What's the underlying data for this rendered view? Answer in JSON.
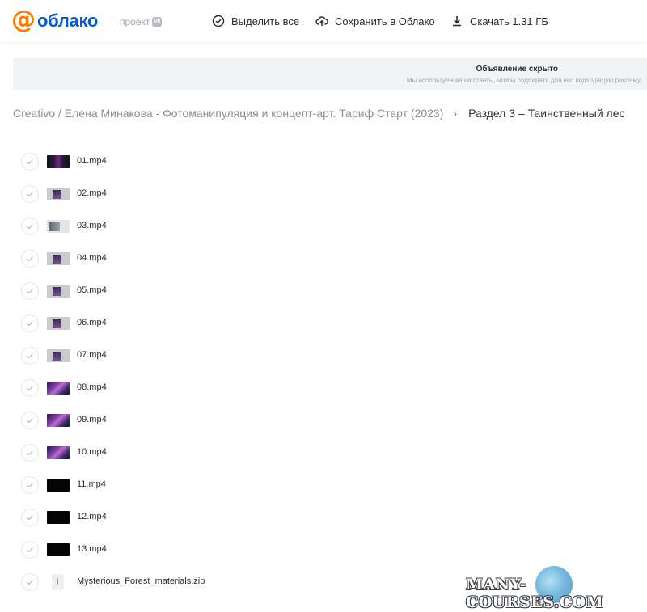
{
  "header": {
    "logo_text": "облако",
    "project_label": "проект",
    "vk_badge": "vk",
    "actions": [
      {
        "label": "Выделить все",
        "icon": "check-circle-icon"
      },
      {
        "label": "Сохранить в Облако",
        "icon": "cloud-upload-icon"
      },
      {
        "label": "Скачать 1.31 ГБ",
        "icon": "download-icon"
      }
    ]
  },
  "ad": {
    "title": "Объявление скрыто",
    "subtitle": "Мы используем ваши ответы, чтобы подбирать для вас подходящую рекламу"
  },
  "breadcrumb": {
    "parent": "Creativo / Елена Минакова - Фотоманипуляция и концепт-арт. Тариф Старт (2023)",
    "current": "Раздел 3 – Таинственный лес"
  },
  "files": [
    {
      "name": "01.mp4",
      "thumb": "dark-purple"
    },
    {
      "name": "02.mp4",
      "thumb": "gray"
    },
    {
      "name": "03.mp4",
      "thumb": "gray-light"
    },
    {
      "name": "04.mp4",
      "thumb": "gray"
    },
    {
      "name": "05.mp4",
      "thumb": "gray"
    },
    {
      "name": "06.mp4",
      "thumb": "gray"
    },
    {
      "name": "07.mp4",
      "thumb": "gray"
    },
    {
      "name": "08.mp4",
      "thumb": "purple"
    },
    {
      "name": "09.mp4",
      "thumb": "purple"
    },
    {
      "name": "10.mp4",
      "thumb": "purple"
    },
    {
      "name": "11.mp4",
      "thumb": "black"
    },
    {
      "name": "12.mp4",
      "thumb": "black"
    },
    {
      "name": "13.mp4",
      "thumb": "black"
    },
    {
      "name": "Mysterious_Forest_materials.zip",
      "thumb": "zip"
    }
  ],
  "watermark": {
    "text": "MANY-COURSES.COM"
  },
  "colors": {
    "logo_accent": "#ff7a00",
    "logo_text": "#005bd1",
    "text_primary": "#2c2d2e",
    "text_muted": "#8a8d93",
    "ad_background": "#f2f4f8"
  }
}
